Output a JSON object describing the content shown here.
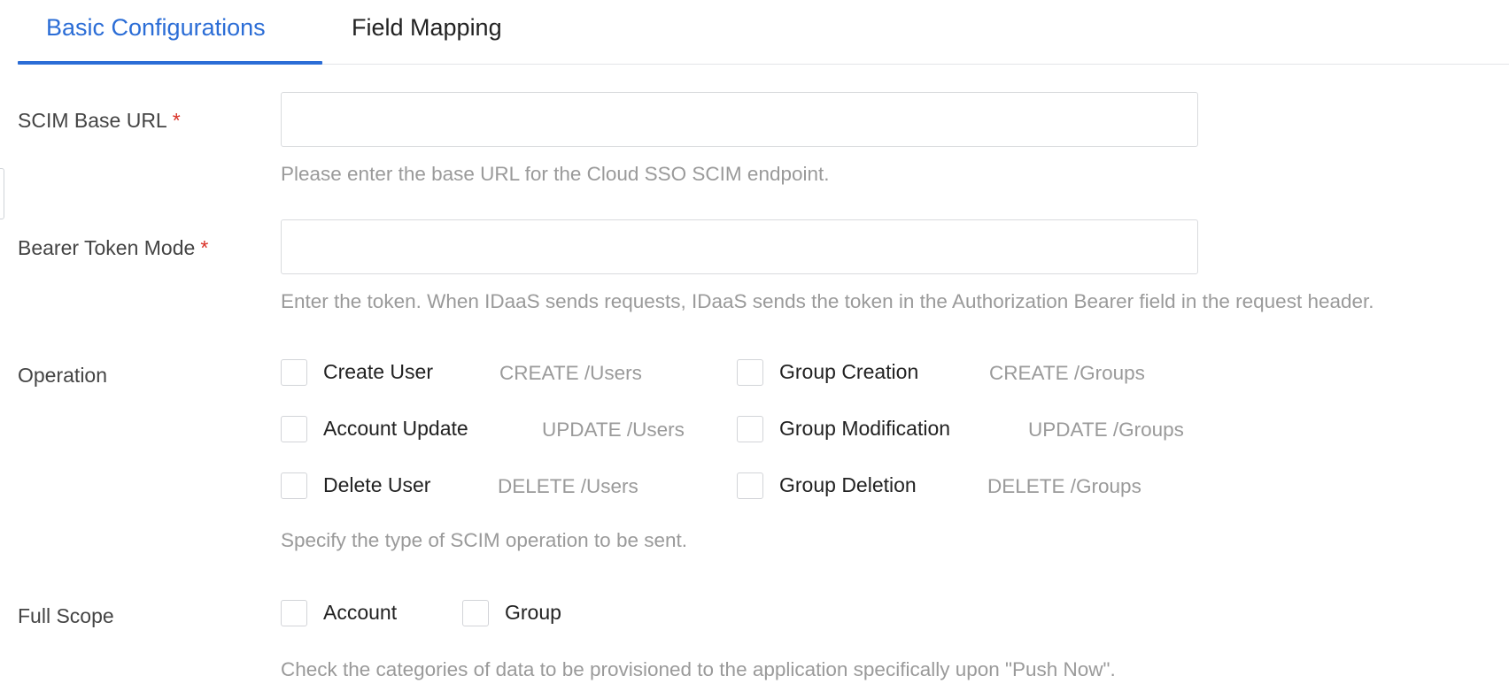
{
  "tabs": [
    {
      "label": "Basic Configurations",
      "active": true
    },
    {
      "label": "Field Mapping",
      "active": false
    }
  ],
  "colors": {
    "accent": "#2b6dd6",
    "required": "#d93026",
    "hint_text": "#9a9a9a",
    "border": "#d9dbde"
  },
  "scim_base_url": {
    "label": "SCIM Base URL",
    "required_mark": "*",
    "value": "",
    "hint": "Please enter the base URL for the Cloud SSO SCIM endpoint."
  },
  "bearer_token": {
    "label": "Bearer Token Mode",
    "required_mark": "*",
    "value": "",
    "hint": "Enter the token. When IDaaS sends requests, IDaaS sends the token in the Authorization Bearer field in the request header."
  },
  "operation": {
    "label": "Operation",
    "options": [
      {
        "label": "Create User",
        "code": "CREATE /Users",
        "checked": false
      },
      {
        "label": "Group Creation",
        "code": "CREATE /Groups",
        "checked": false
      },
      {
        "label": "Account Update",
        "code": "UPDATE /Users",
        "checked": false
      },
      {
        "label": "Group Modification",
        "code": "UPDATE /Groups",
        "checked": false
      },
      {
        "label": "Delete User",
        "code": "DELETE /Users",
        "checked": false
      },
      {
        "label": "Group Deletion",
        "code": "DELETE /Groups",
        "checked": false
      }
    ],
    "hint": "Specify the type of SCIM operation to be sent."
  },
  "full_scope": {
    "label": "Full Scope",
    "options": [
      {
        "label": "Account",
        "checked": false
      },
      {
        "label": "Group",
        "checked": false
      }
    ],
    "hint": "Check the categories of data to be provisioned to the application specifically upon \"Push Now\"."
  }
}
